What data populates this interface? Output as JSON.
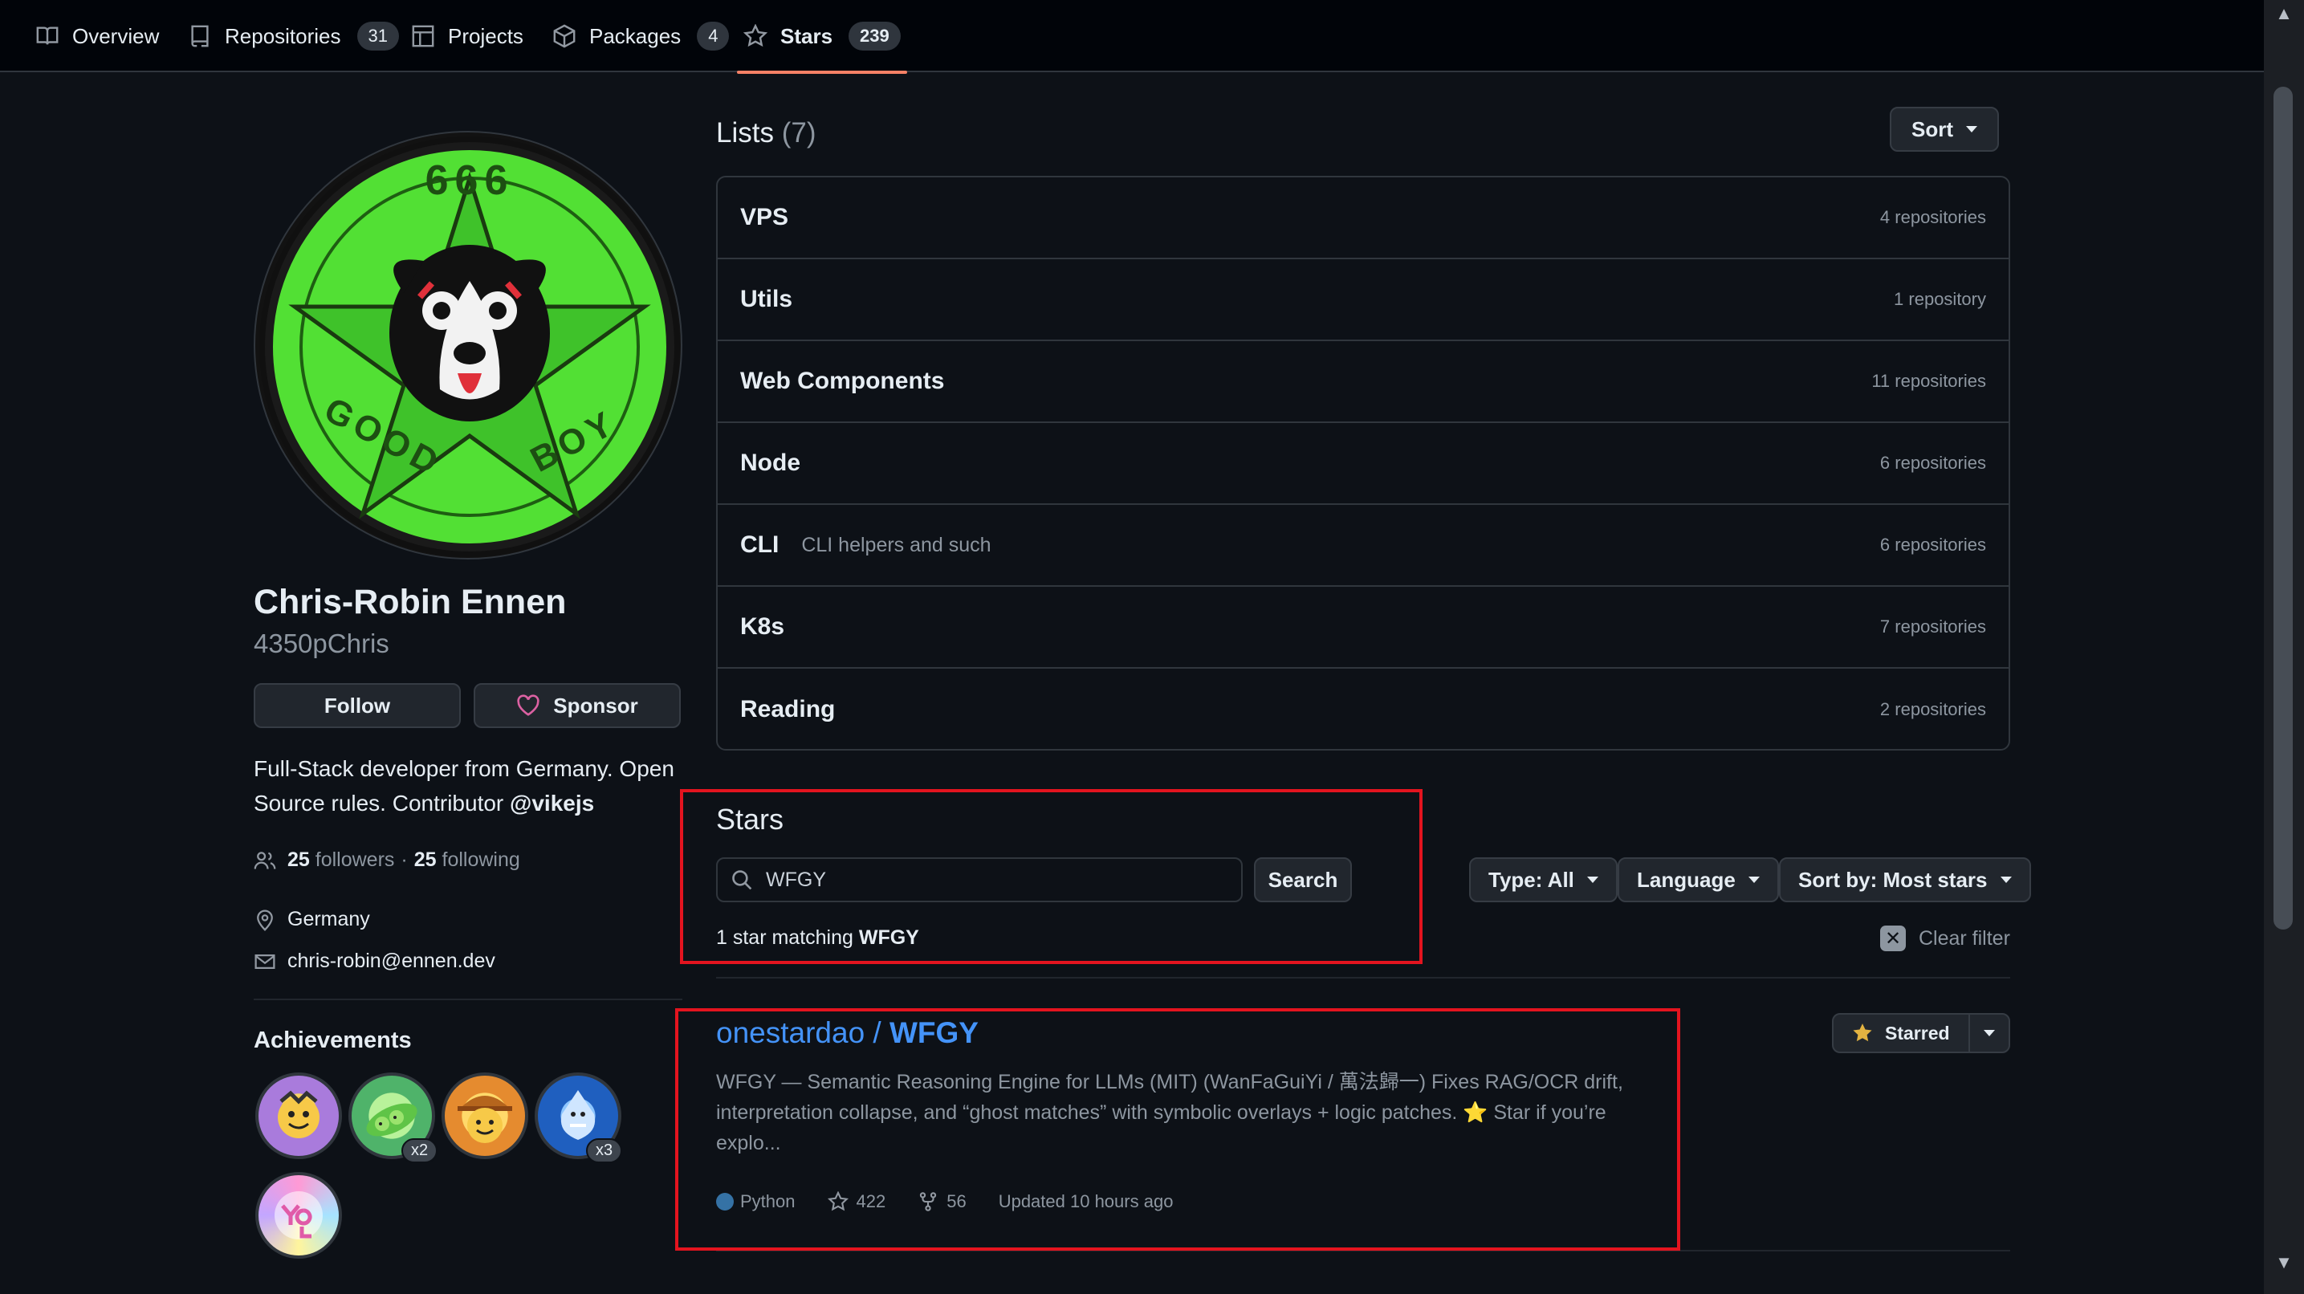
{
  "nav": {
    "tabs": [
      {
        "label": "Overview",
        "icon": "book-icon"
      },
      {
        "label": "Repositories",
        "count": "31",
        "icon": "repo-icon"
      },
      {
        "label": "Projects",
        "icon": "table-icon"
      },
      {
        "label": "Packages",
        "count": "4",
        "icon": "package-icon"
      },
      {
        "label": "Stars",
        "count": "239",
        "icon": "star-icon",
        "active": true
      }
    ]
  },
  "profile": {
    "name": "Chris-Robin Ennen",
    "login": "4350pChris",
    "follow_label": "Follow",
    "sponsor_label": "Sponsor",
    "bio_text": "Full-Stack developer from Germany. Open Source rules. Contributor ",
    "bio_mention": "@vikejs",
    "followers_count": "25",
    "followers_label": "followers",
    "following_count": "25",
    "following_label": "following",
    "location": "Germany",
    "email": "chris-robin@ennen.dev",
    "achievements_title": "Achievements",
    "badges": [
      {
        "name": "badge-1",
        "multiplier": ""
      },
      {
        "name": "badge-2",
        "multiplier": "x2"
      },
      {
        "name": "badge-3",
        "multiplier": ""
      },
      {
        "name": "badge-4",
        "multiplier": "x3"
      },
      {
        "name": "badge-5",
        "multiplier": ""
      }
    ],
    "avatar_text": {
      "top": "666",
      "good": "GOOD",
      "boy": "BOY"
    }
  },
  "lists": {
    "title": "Lists",
    "count": "(7)",
    "sort_label": "Sort",
    "items": [
      {
        "name": "VPS",
        "desc": "",
        "count": "4 repositories"
      },
      {
        "name": "Utils",
        "desc": "",
        "count": "1 repository"
      },
      {
        "name": "Web Components",
        "desc": "",
        "count": "11 repositories"
      },
      {
        "name": "Node",
        "desc": "",
        "count": "6 repositories"
      },
      {
        "name": "CLI",
        "desc": "CLI helpers and such",
        "count": "6 repositories"
      },
      {
        "name": "K8s",
        "desc": "",
        "count": "7 repositories"
      },
      {
        "name": "Reading",
        "desc": "",
        "count": "2 repositories"
      }
    ]
  },
  "stars": {
    "title": "Stars",
    "search_value": "WFGY",
    "search_button": "Search",
    "match_prefix": "1 star matching ",
    "match_term": "WFGY",
    "filter_type": "Type: All",
    "filter_language": "Language",
    "filter_sort": "Sort by: Most stars",
    "clear_filter": "Clear filter"
  },
  "repo": {
    "owner": "onestardao",
    "slash": " / ",
    "name": "WFGY",
    "description": "WFGY — Semantic Reasoning Engine for LLMs (MIT) (WanFaGuiYi / 萬法歸一) Fixes RAG/OCR drift, interpretation collapse, and “ghost matches” with symbolic overlays + logic patches. ⭐ Star if you’re explo...",
    "language": "Python",
    "language_color": "#3572a5",
    "stars": "422",
    "forks": "56",
    "updated": "Updated 10 hours ago",
    "starred_label": "Starred"
  },
  "colors": {
    "accent_link": "#4493f8",
    "tab_underline": "#f78166",
    "annotation_red": "#e3141f",
    "star_yellow": "#e3b341"
  }
}
